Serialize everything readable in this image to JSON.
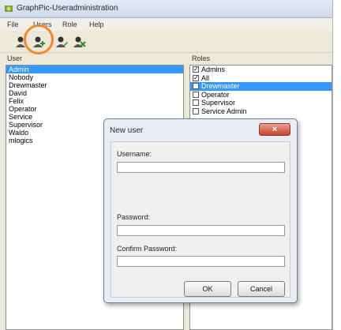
{
  "window": {
    "title": "GraphPic-Useradministration"
  },
  "menu": [
    "File",
    "Users",
    "Role",
    "Help"
  ],
  "toolbar": {
    "icons": [
      "user-icon",
      "add-user-icon",
      "edit-user-icon",
      "delete-user-icon"
    ]
  },
  "users_panel": {
    "label": "User",
    "items": [
      "Admin",
      "Nobody",
      "Drewmaster",
      "David",
      "Felix",
      "Operator",
      "Service",
      "Supervisor",
      "Waldo",
      "mlogics"
    ],
    "selected_index": 0
  },
  "roles_panel": {
    "label": "Roles",
    "items": [
      {
        "label": "Admins",
        "checked": true
      },
      {
        "label": "All",
        "checked": true
      },
      {
        "label": "Drewmaster",
        "checked": false
      },
      {
        "label": "Operator",
        "checked": false
      },
      {
        "label": "Supervisor",
        "checked": false
      },
      {
        "label": "Service Admin",
        "checked": false
      }
    ],
    "selected_index": 2
  },
  "dialog": {
    "title": "New user",
    "close_label": "×",
    "username_label": "Username:",
    "username_value": "",
    "password_label": "Password:",
    "password_value": "",
    "confirm_label": "Confirm Password:",
    "confirm_value": "",
    "ok_label": "OK",
    "cancel_label": "Cancel"
  },
  "colors": {
    "selection": "#3399ff",
    "highlight_ring": "#f4872a",
    "close_button": "#c5452c"
  }
}
